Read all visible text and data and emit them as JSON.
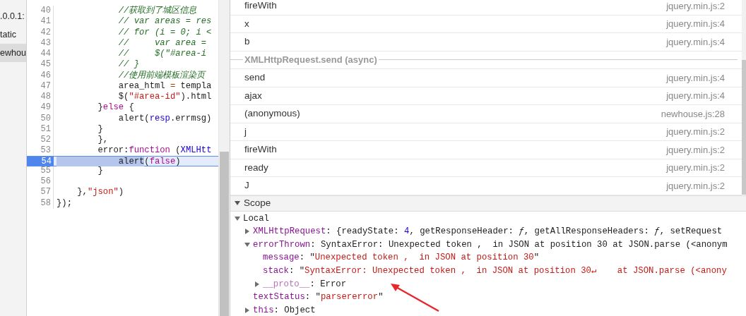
{
  "file_tree": [
    {
      "label": ".0.0.1:",
      "selected": false
    },
    {
      "label": "tatic",
      "selected": false
    },
    {
      "label": "ewhou",
      "selected": true
    }
  ],
  "editor": {
    "lines": [
      {
        "number": "40",
        "breakpoint": false,
        "tokens": [
          {
            "kind": "comment",
            "text": "            //获取到了城区信息"
          }
        ]
      },
      {
        "number": "41",
        "breakpoint": false,
        "tokens": [
          {
            "kind": "comment",
            "text": "            // var areas = res"
          }
        ]
      },
      {
        "number": "42",
        "breakpoint": false,
        "tokens": [
          {
            "kind": "comment",
            "text": "            // for (i = 0; i <"
          }
        ]
      },
      {
        "number": "43",
        "breakpoint": false,
        "tokens": [
          {
            "kind": "comment",
            "text": "            //     var area ="
          }
        ]
      },
      {
        "number": "44",
        "breakpoint": false,
        "tokens": [
          {
            "kind": "comment",
            "text": "            //     $(\"#area-i"
          }
        ]
      },
      {
        "number": "45",
        "breakpoint": false,
        "tokens": [
          {
            "kind": "comment",
            "text": "            // }"
          }
        ]
      },
      {
        "number": "46",
        "breakpoint": false,
        "tokens": [
          {
            "kind": "comment",
            "text": "            //使用前端模板渲染页"
          }
        ]
      },
      {
        "number": "47",
        "breakpoint": false,
        "tokens": [
          {
            "kind": "plain",
            "text": "            area_html "
          },
          {
            "kind": "operator",
            "text": "="
          },
          {
            "kind": "plain",
            "text": " templa"
          }
        ]
      },
      {
        "number": "48",
        "breakpoint": false,
        "tokens": [
          {
            "kind": "plain",
            "text": "            $("
          },
          {
            "kind": "string",
            "text": "\"#area-id\""
          },
          {
            "kind": "plain",
            "text": ").html"
          }
        ]
      },
      {
        "number": "49",
        "breakpoint": false,
        "tokens": [
          {
            "kind": "plain",
            "text": "        }"
          },
          {
            "kind": "keyword",
            "text": "else"
          },
          {
            "kind": "plain",
            "text": " {"
          }
        ]
      },
      {
        "number": "50",
        "breakpoint": false,
        "tokens": [
          {
            "kind": "plain",
            "text": "            alert("
          },
          {
            "kind": "ident",
            "text": "resp"
          },
          {
            "kind": "plain",
            "text": ".errmsg)"
          }
        ]
      },
      {
        "number": "51",
        "breakpoint": false,
        "tokens": [
          {
            "kind": "plain",
            "text": "        }"
          }
        ]
      },
      {
        "number": "52",
        "breakpoint": false,
        "tokens": [
          {
            "kind": "plain",
            "text": "        },"
          }
        ]
      },
      {
        "number": "53",
        "breakpoint": false,
        "tokens": [
          {
            "kind": "plain",
            "text": "        error:"
          },
          {
            "kind": "keyword",
            "text": "function"
          },
          {
            "kind": "plain",
            "text": " ("
          },
          {
            "kind": "ident",
            "text": "XMLHtt"
          }
        ]
      },
      {
        "number": "54",
        "breakpoint": true,
        "tokens": [
          {
            "kind": "selection",
            "text": "            alert"
          },
          {
            "kind": "plain",
            "text": "("
          },
          {
            "kind": "keyword",
            "text": "false"
          },
          {
            "kind": "plain",
            "text": ")"
          }
        ]
      },
      {
        "number": "55",
        "breakpoint": false,
        "tokens": [
          {
            "kind": "plain",
            "text": "        }"
          }
        ]
      },
      {
        "number": "56",
        "breakpoint": false
      },
      {
        "number": "57",
        "breakpoint": false,
        "tokens": [
          {
            "kind": "plain",
            "text": "    },"
          },
          {
            "kind": "string",
            "text": "\"json\""
          },
          {
            "kind": "plain",
            "text": ")"
          }
        ]
      },
      {
        "number": "58",
        "breakpoint": false,
        "tokens": [
          {
            "kind": "plain",
            "text": "});"
          }
        ]
      }
    ]
  },
  "call_stack": [
    {
      "kind": "frame",
      "name": "fireWith",
      "location": "jquery.min.js:2"
    },
    {
      "kind": "frame",
      "name": "x",
      "location": "jquery.min.js:4"
    },
    {
      "kind": "frame",
      "name": "b",
      "location": "jquery.min.js:4"
    },
    {
      "kind": "async",
      "name": "XMLHttpRequest.send (async)"
    },
    {
      "kind": "frame",
      "name": "send",
      "location": "jquery.min.js:4"
    },
    {
      "kind": "frame",
      "name": "ajax",
      "location": "jquery.min.js:4"
    },
    {
      "kind": "frame",
      "name": "(anonymous)",
      "location": "newhouse.js:28"
    },
    {
      "kind": "frame",
      "name": "j",
      "location": "jquery.min.js:2"
    },
    {
      "kind": "frame",
      "name": "fireWith",
      "location": "jquery.min.js:2"
    },
    {
      "kind": "frame",
      "name": "ready",
      "location": "jquery.min.js:2"
    },
    {
      "kind": "frame",
      "name": "J",
      "location": "jquery.min.js:2"
    }
  ],
  "scope": {
    "title": "Scope",
    "expanded": true,
    "tree": [
      {
        "kind": "group",
        "expanded": true,
        "name": "Local",
        "children": [
          {
            "kind": "group",
            "expanded": false,
            "name": "XMLHttpRequest",
            "value": [
              {
                "kind": "plain",
                "text": ": {readyState: "
              },
              {
                "kind": "number",
                "text": "4"
              },
              {
                "kind": "plain",
                "text": ", getResponseHeader: "
              },
              {
                "kind": "func",
                "text": "ƒ"
              },
              {
                "kind": "plain",
                "text": ", getAllResponseHeaders: "
              },
              {
                "kind": "func",
                "text": "ƒ"
              },
              {
                "kind": "plain",
                "text": ", setRequest"
              }
            ]
          },
          {
            "kind": "group",
            "expanded": true,
            "name": "errorThrown",
            "value": [
              {
                "kind": "plain",
                "text": ": SyntaxError: Unexpected token ,  in JSON at position 30 at JSON.parse (<anonym"
              }
            ],
            "children": [
              {
                "kind": "leaf",
                "name": "message",
                "value": [
                  {
                    "kind": "plain",
                    "text": ": \""
                  },
                  {
                    "kind": "string",
                    "text": "Unexpected token ,  in JSON at position 30"
                  },
                  {
                    "kind": "plain",
                    "text": "\""
                  }
                ]
              },
              {
                "kind": "leaf",
                "name": "stack",
                "value": [
                  {
                    "kind": "plain",
                    "text": ": \""
                  },
                  {
                    "kind": "string",
                    "text": "SyntaxError: Unexpected token ,  in JSON at position 30↵    at JSON.parse (<anony"
                  }
                ]
              },
              {
                "kind": "group",
                "expanded": false,
                "name": "__proto__",
                "value": [
                  {
                    "kind": "plain",
                    "text": ": Error"
                  }
                ]
              }
            ]
          },
          {
            "kind": "leaf",
            "name": "textStatus",
            "value": [
              {
                "kind": "plain",
                "text": ": \""
              },
              {
                "kind": "string",
                "text": "parsererror"
              },
              {
                "kind": "plain",
                "text": "\""
              }
            ]
          },
          {
            "kind": "group",
            "expanded": false,
            "name": "this",
            "value": [
              {
                "kind": "plain",
                "text": ": Object"
              }
            ]
          }
        ]
      }
    ]
  }
}
